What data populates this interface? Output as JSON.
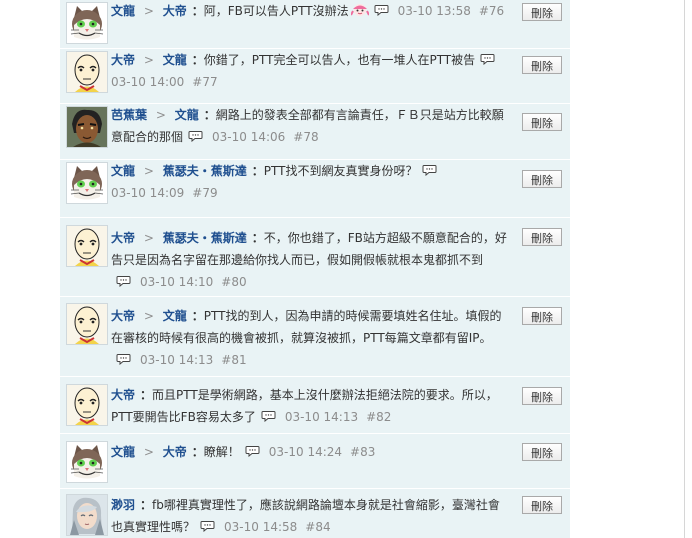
{
  "comments": [
    {
      "author": "文龍",
      "arrow": ">",
      "target": "大帝",
      "colon": "：",
      "text": "阿，FB可以告人PTT沒辦法",
      "time": "03-10 13:58",
      "num": "#76",
      "delete_label": "刪除",
      "avatar": "cat-avatar-icon",
      "inline_icon": "pink-character-emoji-icon"
    },
    {
      "author": "大帝",
      "arrow": ">",
      "target": "文龍",
      "colon": "：",
      "text": "你錯了，PTT完全可以告人，也有一堆人在PTT被告",
      "time": "03-10 14:00",
      "num": "#77",
      "delete_label": "刪除",
      "avatar": "bald-hero-avatar-icon"
    },
    {
      "author": "芭蕉葉",
      "arrow": ">",
      "target": "文龍",
      "colon": "：",
      "text": "網路上的發表全部都有言論責任，ＦＢ只是站方比較願意配合的那個",
      "time": "03-10 14:06",
      "num": "#78",
      "delete_label": "刪除",
      "avatar": "dark-man-avatar-icon"
    },
    {
      "author": "文龍",
      "arrow": ">",
      "target": "蕉瑟夫・蕉斯達",
      "colon": "：",
      "text": "PTT找不到網友真實身份呀？",
      "time": "03-10 14:09",
      "num": "#79",
      "delete_label": "刪除",
      "avatar": "cat-avatar-icon"
    },
    {
      "author": "大帝",
      "arrow": ">",
      "target": "蕉瑟夫・蕉斯達",
      "colon": "：",
      "text": "不，你也錯了，FB站方超級不願意配合的，好告只是因為名字留在那邊給你找人而已，假如開假帳就根本鬼都抓不到",
      "time": "03-10 14:10",
      "num": "#80",
      "delete_label": "刪除",
      "avatar": "bald-hero-avatar-icon"
    },
    {
      "author": "大帝",
      "arrow": ">",
      "target": "文龍",
      "colon": "：",
      "text": "PTT找的到人，因為申請的時候需要填姓名住址。填假的在審核的時候有很高的機會被抓，就算沒被抓，PTT每篇文章都有留IP。",
      "time": "03-10 14:13",
      "num": "#81",
      "delete_label": "刪除",
      "avatar": "bald-hero-avatar-icon"
    },
    {
      "author": "大帝",
      "colon": "：",
      "text": "而且PTT是學術網路，基本上沒什麼辦法拒絕法院的要求。所以，PTT要開告比FB容易太多了",
      "time": "03-10 14:13",
      "num": "#82",
      "delete_label": "刪除",
      "avatar": "bald-hero-avatar-icon"
    },
    {
      "author": "文龍",
      "arrow": ">",
      "target": "大帝",
      "colon": "：",
      "text": "瞭解！",
      "time": "03-10 14:24",
      "num": "#83",
      "delete_label": "刪除",
      "avatar": "cat-avatar-icon"
    },
    {
      "author": "渺羽",
      "colon": "：",
      "text": "fb哪裡真實理性了，應該說網路論壇本身就是社會縮影，臺灣社會也真實理性嗎？",
      "time": "03-10 14:58",
      "num": "#84",
      "delete_label": "刪除",
      "avatar": "silver-hair-avatar-icon"
    }
  ],
  "icons": {
    "reply": "reply-bubble-icon"
  },
  "colors": {
    "row_background": "#e9f3f5",
    "name_blue": "#1f4f8f",
    "meta_gray": "#8c8c8c"
  }
}
